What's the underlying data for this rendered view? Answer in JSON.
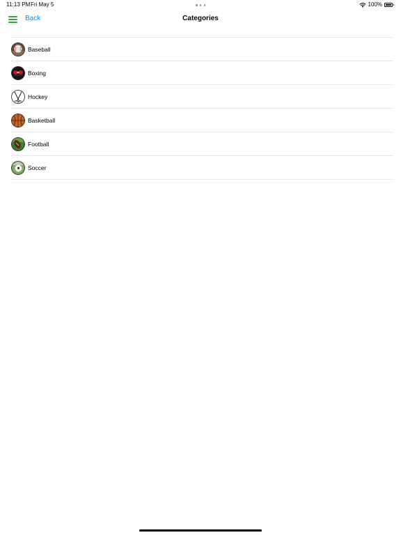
{
  "status_bar": {
    "time": "11:13 PM",
    "date": "Fri May 5",
    "battery": "100%"
  },
  "nav": {
    "back_label": "Back",
    "title": "Categories"
  },
  "categories": [
    {
      "label": "Baseball",
      "icon": "baseball-icon"
    },
    {
      "label": "Boxing",
      "icon": "boxing-icon"
    },
    {
      "label": "Hockey",
      "icon": "hockey-icon"
    },
    {
      "label": "Basketball",
      "icon": "basketball-icon"
    },
    {
      "label": "Football",
      "icon": "football-icon"
    },
    {
      "label": "Soccer",
      "icon": "soccer-icon"
    }
  ],
  "colors": {
    "accent_blue": "#1a8ce6",
    "menu_green": "#3aa13a",
    "separator": "#e6e6e6"
  }
}
